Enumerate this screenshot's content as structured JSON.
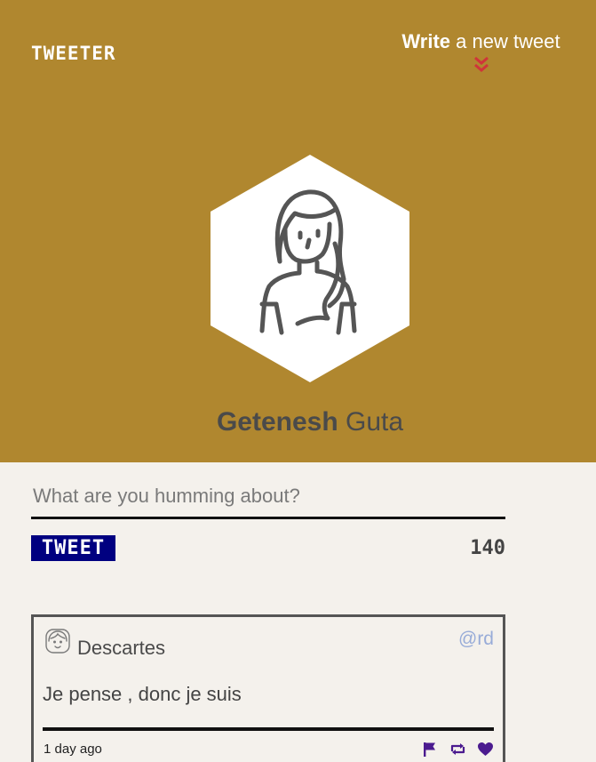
{
  "header": {
    "brand": "TWEETER",
    "compose_toggle": {
      "label_first": "Write",
      "label_rest": "a new tweet",
      "icon": "double-chevron-down-icon",
      "icon_color": "#d0343a"
    },
    "background_color": "#b0872f"
  },
  "profile": {
    "avatar_icon": "person-avatar-icon",
    "name_first": "Getenesh",
    "name_last": "Guta"
  },
  "composer": {
    "placeholder": "What are you humming about?",
    "value": "",
    "submit_label": "TWEET",
    "submit_color": "#000080",
    "char_counter": "140"
  },
  "tweets": [
    {
      "avatar_icon": "user-face-icon",
      "author": "Descartes",
      "handle": "@rd",
      "text": "Je pense , donc je suis",
      "time": "1 day ago",
      "actions": [
        "flag-icon",
        "retweet-icon",
        "heart-icon"
      ],
      "action_color": "#4b1b8f"
    }
  ]
}
